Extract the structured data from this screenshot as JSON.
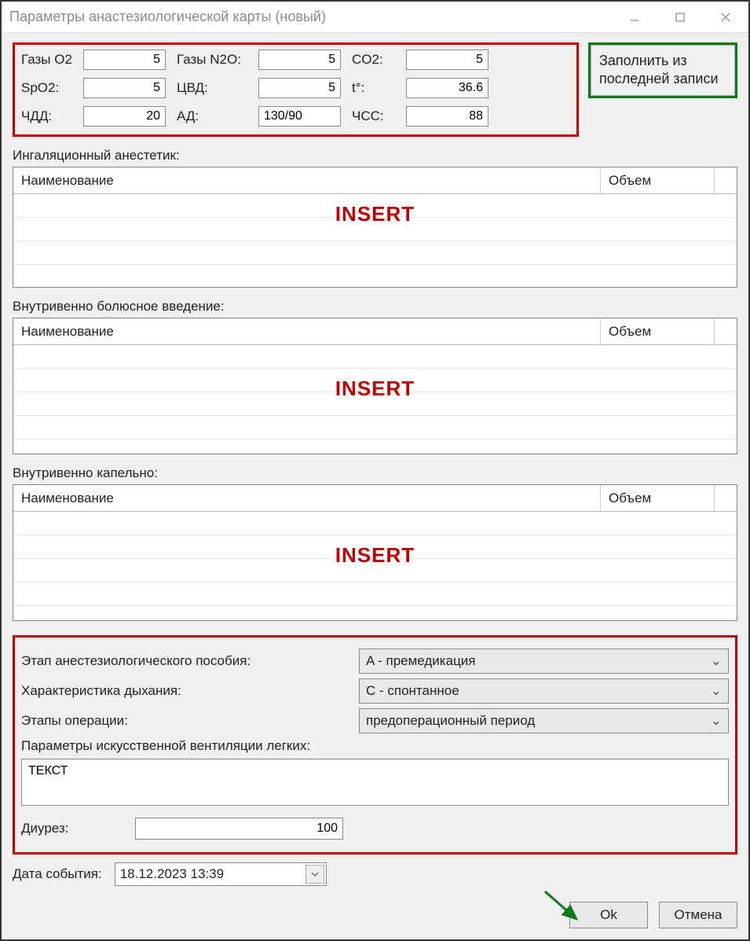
{
  "window": {
    "title": "Параметры анастезиологической карты (новый)"
  },
  "fill_button": "Заполнить из последней записи",
  "params": {
    "labels": {
      "gas_o2": "Газы O2",
      "gas_n2o": "Газы N2O:",
      "co2": "CO2:",
      "spo2": "SpO2:",
      "cvd": "ЦВД:",
      "temp": "t°:",
      "chdd": "ЧДД:",
      "ad": "АД:",
      "chss": "ЧСС:"
    },
    "values": {
      "gas_o2": "5",
      "gas_n2o": "5",
      "co2": "5",
      "spo2": "5",
      "cvd": "5",
      "temp": "36.6",
      "chdd": "20",
      "ad": "130/90",
      "chss": "88"
    }
  },
  "sections": {
    "inhal": {
      "label": "Ингаляционный анестетик:",
      "col_name": "Наименование",
      "col_vol": "Объем",
      "hint": "INSERT"
    },
    "bolus": {
      "label": "Внутривенно болюсное введение:",
      "col_name": "Наименование",
      "col_vol": "Объем",
      "hint": "INSERT"
    },
    "drip": {
      "label": "Внутривенно капельно:",
      "col_name": "Наименование",
      "col_vol": "Объем",
      "hint": "INSERT"
    }
  },
  "bottom": {
    "stage_label": "Этап анестезиологического пособия:",
    "stage_value": "A - премедикация",
    "breath_label": "Характеристика дыхания:",
    "breath_value": "С - спонтанное",
    "opstage_label": "Этапы операции:",
    "opstage_value": "предоперационный период",
    "vent_label": "Параметры искусственной вентиляции легких:",
    "vent_text": "ТЕКСТ",
    "diuresis_label": "Диурез:",
    "diuresis_value": "100"
  },
  "date": {
    "label": "Дата события:",
    "value": "18.12.2023 13:39"
  },
  "buttons": {
    "ok": "Ok",
    "cancel": "Отмена"
  }
}
